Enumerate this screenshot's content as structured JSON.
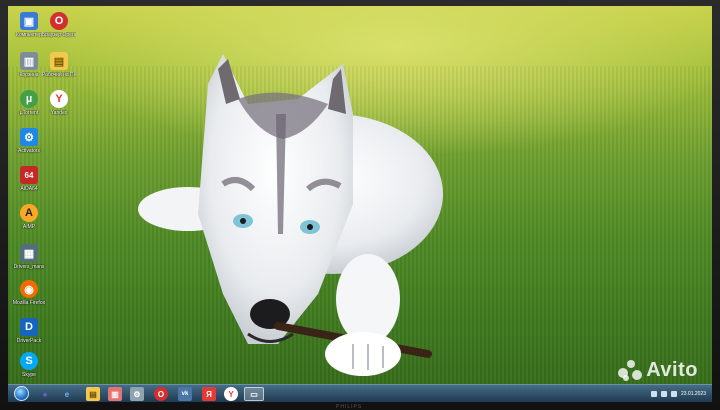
{
  "desktop": {
    "icons": [
      {
        "name": "computer-icon",
        "label": "Компьютер",
        "color": "#3a7bd5",
        "glyph": "▣"
      },
      {
        "name": "opera-icon",
        "label": "Браузер Opera",
        "color": "#d32f2f",
        "glyph": "O"
      },
      {
        "name": "recycle-bin-icon",
        "label": "Корзина",
        "color": "#7e8c99",
        "glyph": "▥"
      },
      {
        "name": "folder-icon",
        "label": "Рабочий на ПК",
        "color": "#f2c94c",
        "glyph": "▤"
      },
      {
        "name": "utorrent-icon",
        "label": "µTorrent",
        "color": "#43a047",
        "glyph": "µ"
      },
      {
        "name": "yandex-icon",
        "label": "Yandex",
        "color": "#ffffff",
        "glyph": "Y"
      },
      {
        "name": "activators-icon",
        "label": "Activators",
        "color": "#1e88e5",
        "glyph": "⚙"
      },
      {
        "name": "aida64-icon",
        "label": "AIDA64",
        "color": "#c62828",
        "glyph": "64"
      },
      {
        "name": "aimp-icon",
        "label": "AIMP",
        "color": "#f9a825",
        "glyph": "A"
      },
      {
        "name": "drivers-icon",
        "label": "Drivers_mans",
        "color": "#546e7a",
        "glyph": "▦"
      },
      {
        "name": "firefox-icon",
        "label": "Mozilla Firefox",
        "color": "#ef6c00",
        "glyph": "◉"
      },
      {
        "name": "driverpack-icon",
        "label": "DriverPack",
        "color": "#1565c0",
        "glyph": "D"
      },
      {
        "name": "skype-icon",
        "label": "Skype",
        "color": "#03a9f4",
        "glyph": "S"
      }
    ]
  },
  "taskbar": {
    "clock_time": "",
    "clock_date": "23.01.2023",
    "buttons": [
      {
        "name": "taskbar-media-icon",
        "color": "#7b5cd6",
        "glyph": "●"
      },
      {
        "name": "taskbar-ie-icon",
        "color": "#1e88e5",
        "glyph": "e"
      },
      {
        "name": "taskbar-explorer-icon",
        "color": "#f2c94c",
        "glyph": "▤"
      },
      {
        "name": "taskbar-app-icon",
        "color": "#e57373",
        "glyph": "▥"
      },
      {
        "name": "taskbar-tool-icon",
        "color": "#90a4ae",
        "glyph": "⚙"
      },
      {
        "name": "taskbar-opera-icon",
        "color": "#d32f2f",
        "glyph": "O"
      },
      {
        "name": "taskbar-vk-icon",
        "color": "#4a76a8",
        "glyph": "vk"
      },
      {
        "name": "taskbar-yandex-icon",
        "color": "#e53935",
        "glyph": "Я"
      },
      {
        "name": "taskbar-browser-icon",
        "color": "#ffffff",
        "glyph": "Y"
      },
      {
        "name": "taskbar-window-icon",
        "color": "#64b5f6",
        "glyph": "▭"
      }
    ]
  },
  "watermark": {
    "text": "Avito"
  },
  "monitor": {
    "brand": "PHILIPS"
  }
}
